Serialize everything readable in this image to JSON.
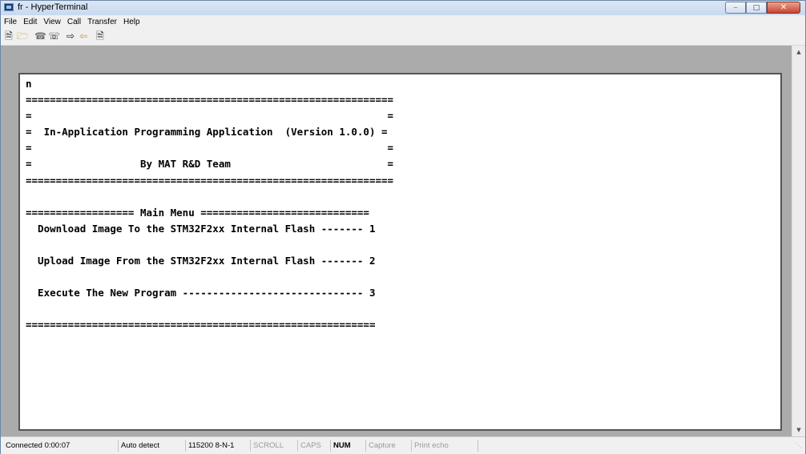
{
  "window": {
    "title": "fr - HyperTerminal"
  },
  "menu": [
    "File",
    "Edit",
    "View",
    "Call",
    "Transfer",
    "Help"
  ],
  "toolbar": [
    "new-icon",
    "open-icon",
    "phone-icon",
    "hangup-icon",
    "send-icon",
    "receive-icon",
    "properties-icon"
  ],
  "terminal": {
    "lines": [
      "n",
      "=============================================================",
      "=                                                           =",
      "=  In-Application Programming Application  (Version 1.0.0) =",
      "=                                                           =",
      "=                  By MAT R&D Team                          =",
      "=============================================================",
      "",
      "================== Main Menu ============================",
      "  Download Image To the STM32F2xx Internal Flash ------- 1",
      "",
      "  Upload Image From the STM32F2xx Internal Flash ------- 2",
      "",
      "  Execute The New Program ------------------------------ 3",
      "",
      "=========================================================="
    ]
  },
  "status": {
    "connected": "Connected 0:00:07",
    "detect": "Auto detect",
    "params": "115200 8-N-1",
    "scroll": "SCROLL",
    "caps": "CAPS",
    "num": "NUM",
    "capture": "Capture",
    "print_echo": "Print echo"
  }
}
